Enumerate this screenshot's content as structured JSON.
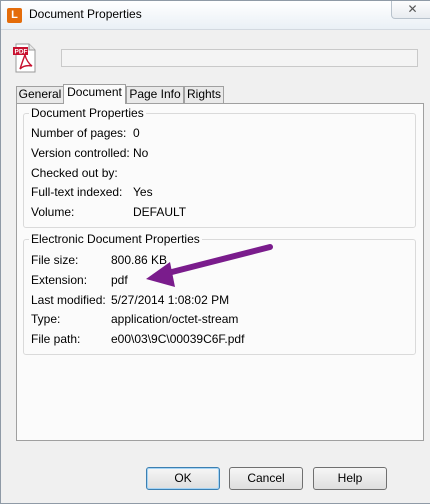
{
  "window": {
    "title": "Document Properties",
    "app_icon_letter": "L",
    "close_glyph": "✕",
    "pdf_badge": "PDF"
  },
  "tabs": [
    {
      "label": "General",
      "active": false
    },
    {
      "label": "Document",
      "active": true
    },
    {
      "label": "Page Info",
      "active": false
    },
    {
      "label": "Rights",
      "active": false
    }
  ],
  "document_properties": {
    "title": "Document Properties",
    "rows": [
      {
        "label": "Number of pages:",
        "value": "0"
      },
      {
        "label": "Version controlled:",
        "value": "No"
      },
      {
        "label": "Checked out by:",
        "value": ""
      },
      {
        "label": "Full-text indexed:",
        "value": "Yes"
      },
      {
        "label": "Volume:",
        "value": "DEFAULT"
      }
    ]
  },
  "electronic_properties": {
    "title": "Electronic Document Properties",
    "rows": [
      {
        "label": "File size:",
        "value": "800.86 KB"
      },
      {
        "label": "Extension:",
        "value": "pdf"
      },
      {
        "label": "Last modified:",
        "value": "5/27/2014 1:08:02 PM"
      },
      {
        "label": "Type:",
        "value": "application/octet-stream"
      },
      {
        "label": "File path:",
        "value": "e00\\03\\9C\\00039C6F.pdf"
      }
    ]
  },
  "buttons": {
    "ok": "OK",
    "cancel": "Cancel",
    "help": "Help"
  },
  "colors": {
    "app_icon": "#e46c0a",
    "pdf_red": "#c8102e",
    "annotation_arrow": "#7a1c8c"
  },
  "icons": {
    "app": "l-app-icon",
    "file": "pdf-file-icon",
    "close": "close-icon",
    "annotation": "purple-arrow-annotation"
  }
}
